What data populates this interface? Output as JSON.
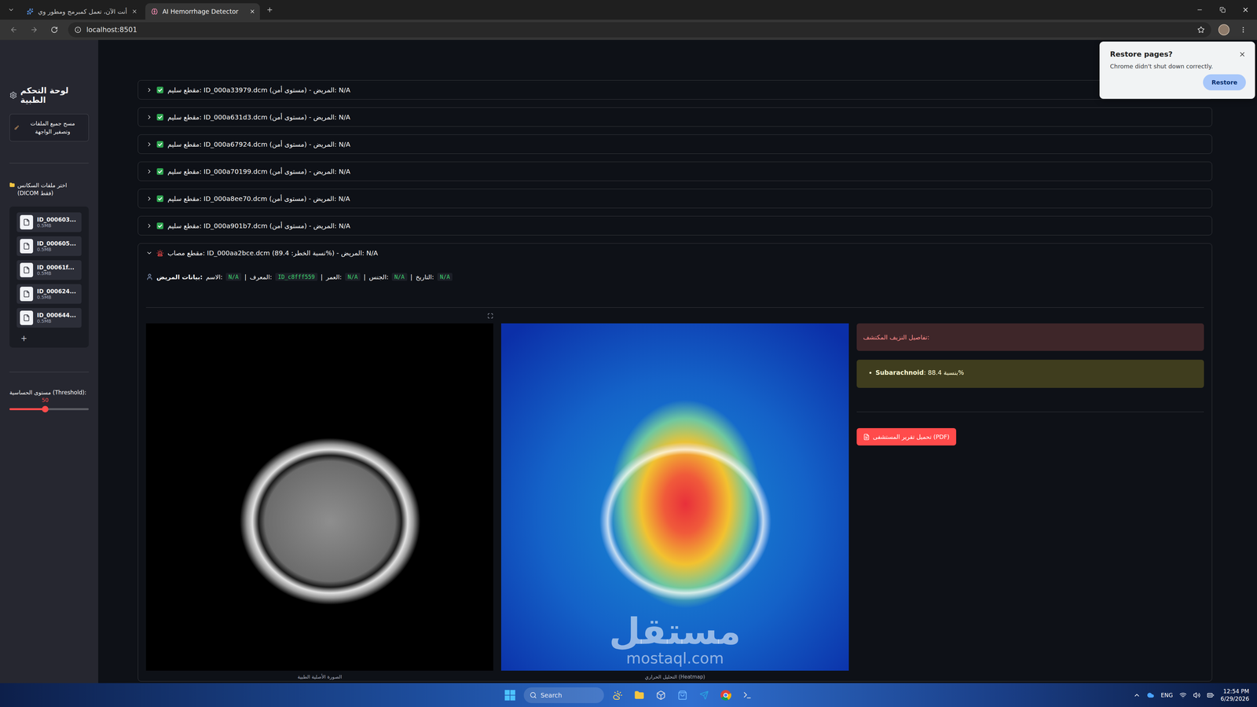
{
  "browser": {
    "tabs": [
      {
        "label": "أنت الآن، تعمل كمبرمج ومطور وي",
        "selected": false
      },
      {
        "label": "AI Hemorrhage Detector",
        "selected": true
      }
    ],
    "address": "localhost:8501"
  },
  "restore_popup": {
    "title": "Restore pages?",
    "message": "Chrome didn't shut down correctly.",
    "button": "Restore"
  },
  "sidebar": {
    "title": "لوحة التحكم الطبية",
    "clear_button": "مسح جميع الملفات وتصفير الواجهة",
    "uploader_label": "اختر ملفات السكانس (DICOM فقط)",
    "files": [
      {
        "name": "ID_000603...",
        "size": "0.5MB"
      },
      {
        "name": "ID_000605...",
        "size": "0.5MB"
      },
      {
        "name": "ID_00061f...",
        "size": "0.5MB"
      },
      {
        "name": "ID_000624...",
        "size": "0.5MB"
      },
      {
        "name": "ID_000644...",
        "size": "0.5MB"
      }
    ],
    "add_symbol": "+",
    "threshold": {
      "label": "مستوى الحساسية (Threshold):",
      "value": "50",
      "level": 0.45
    }
  },
  "results": [
    {
      "label": "مقطع سليم: ID_000a33979.dcm (مستوى أمن) - المريض: N/A",
      "status": "healthy",
      "expanded": false
    },
    {
      "label": "مقطع سليم: ID_000a631d3.dcm (مستوى أمن) - المريض: N/A",
      "status": "healthy",
      "expanded": false
    },
    {
      "label": "مقطع سليم: ID_000a67924.dcm (مستوى أمن) - المريض: N/A",
      "status": "healthy",
      "expanded": false
    },
    {
      "label": "مقطع سليم: ID_000a70199.dcm (مستوى أمن) - المريض: N/A",
      "status": "healthy",
      "expanded": false
    },
    {
      "label": "مقطع سليم: ID_000a8ee70.dcm (مستوى أمن) - المريض: N/A",
      "status": "healthy",
      "expanded": false
    },
    {
      "label": "مقطع سليم: ID_000a901b7.dcm (مستوى أمن) - المريض: N/A",
      "status": "healthy",
      "expanded": false
    },
    {
      "label": "مقطع مصاب: ID_000aa2bce.dcm (نسبة الخطر: 89.4%) - المريض: N/A",
      "status": "injured",
      "expanded": true,
      "detail": {
        "patient_title": "بيانات المريض:",
        "separator": "|",
        "fields": [
          {
            "label": "الاسم:",
            "value": "N/A"
          },
          {
            "label": "المعرف:",
            "value": "ID_c8fff559"
          },
          {
            "label": "العمر:",
            "value": "N/A"
          },
          {
            "label": "الجنس:",
            "value": "N/A"
          },
          {
            "label": "التاريخ:",
            "value": "N/A"
          }
        ],
        "images": [
          {
            "kind": "original",
            "caption": "الصورة الأصلية الطبية"
          },
          {
            "kind": "heatmap",
            "caption": "التحليل الحراري (Heatmap)"
          }
        ],
        "findings_title": "تفاصيل النزيف المكتشف:",
        "findings": [
          {
            "type": "Subarachnoid",
            "value": ": بنسبة 88.4%"
          }
        ],
        "report_button": "تحميل تقرير المستشفى (PDF)"
      }
    }
  ],
  "watermark": {
    "arabic": "مستقل",
    "latin": "mostaql.com"
  },
  "taskbar": {
    "search": "Search",
    "language": "ENG",
    "time": "12:54 PM",
    "date": "6/29/2026"
  }
}
